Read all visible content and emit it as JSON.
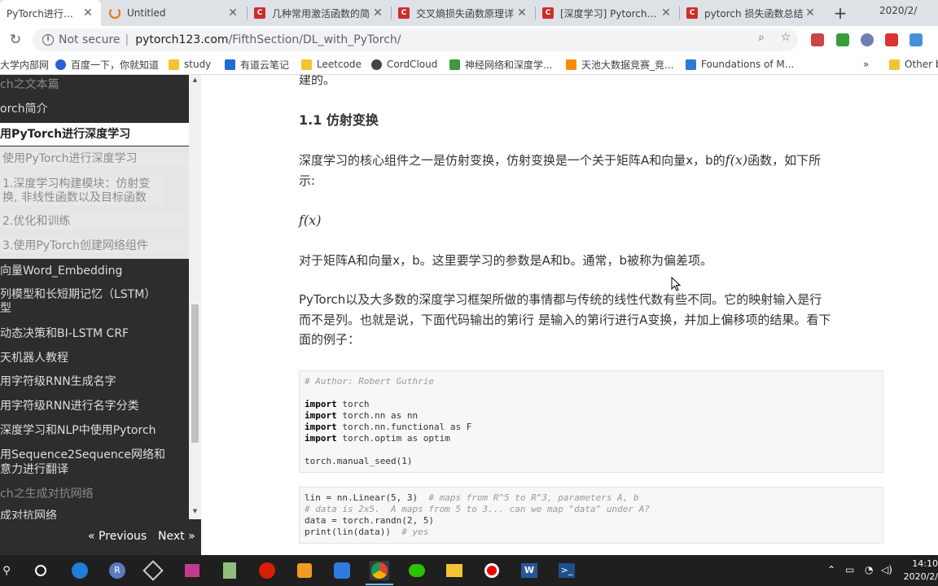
{
  "browser": {
    "tabs": [
      {
        "label": "PyTorch进行深度",
        "icon": "pytorch-favicon",
        "active": true
      },
      {
        "label": "Untitled",
        "icon": "loading-icon",
        "active": false
      },
      {
        "label": "几种常用激活函数的简",
        "icon": "csdn-favicon",
        "active": false
      },
      {
        "label": "交叉熵损失函数原理详",
        "icon": "csdn-favicon",
        "active": false
      },
      {
        "label": "[深度学习] Pytorch nn",
        "icon": "csdn-favicon",
        "active": false
      },
      {
        "label": "pytorch 损失函数总结",
        "icon": "csdn-favicon",
        "active": false
      }
    ],
    "new_tab": "+",
    "date_partial": "2020/2/",
    "omnibox": {
      "security": "Not secure",
      "separator": "|",
      "host": "pytorch123.com",
      "path": "/FifthSection/DL_with_PyTorch/"
    },
    "bookmarks": [
      {
        "label": "大学内部网",
        "icon": "globe-icon"
      },
      {
        "label": "百度一下，你就知道",
        "icon": "baidu-icon"
      },
      {
        "label": "study",
        "icon": "folder-icon"
      },
      {
        "label": "有道云笔记",
        "icon": "youdao-icon"
      },
      {
        "label": "Leetcode",
        "icon": "folder-icon"
      },
      {
        "label": "CordCloud",
        "icon": "cordcloud-icon"
      },
      {
        "label": "神经网络和深度学...",
        "icon": "nn-icon"
      },
      {
        "label": "天池大数据竞赛_竞...",
        "icon": "tianchi-icon"
      },
      {
        "label": "Foundations of M...",
        "icon": "foundations-icon"
      },
      {
        "label": "»",
        "icon": "more-icon"
      },
      {
        "label": "Other b",
        "icon": "folder-icon"
      }
    ]
  },
  "sidebar": {
    "items": [
      {
        "label": "ch之文本篇",
        "style": "dim"
      },
      {
        "label": "orch简介",
        "style": "normal"
      },
      {
        "label": "用PyTorch进行深度学习",
        "style": "active"
      },
      {
        "label": "使用PyTorch进行深度学习",
        "style": "sub"
      },
      {
        "label": "1.深度学习构建模块：仿射变换, 非线性函数以及目标函数",
        "style": "sub"
      },
      {
        "label": "2.优化和训练",
        "style": "sub"
      },
      {
        "label": "3.使用PyTorch创建网络组件",
        "style": "sub"
      },
      {
        "label": "向量Word_Embedding",
        "style": "normal"
      },
      {
        "label": "列模型和长短期记忆（LSTM）",
        "style": "normal"
      },
      {
        "label": "型",
        "style": "normal"
      },
      {
        "label": "动态决策和BI-LSTM CRF",
        "style": "normal"
      },
      {
        "label": "天机器人教程",
        "style": "normal"
      },
      {
        "label": "用字符级RNN生成名字",
        "style": "normal"
      },
      {
        "label": "用字符级RNN进行名字分类",
        "style": "normal"
      },
      {
        "label": "深度学习和NLP中使用Pytorch",
        "style": "normal"
      },
      {
        "label": "用Sequence2Sequence网络和",
        "style": "normal"
      },
      {
        "label": "意力进行翻译",
        "style": "normal"
      },
      {
        "label": "ch之生成对抗网络",
        "style": "dim"
      },
      {
        "label": "成对抗网络",
        "style": "normal"
      }
    ],
    "previous": "« Previous",
    "next": "Next »"
  },
  "content": {
    "top_fragment": "建的。",
    "heading": "1.1 仿射变换",
    "para1_a": "深度学习的核心组件之一是仿射变换，仿射变换是一个关于矩阵A和向量x，b的",
    "para1_math": "f(x)",
    "para1_b": "函数，如下所",
    "para1_c": "示:",
    "formula": "f(x)",
    "para2": "对于矩阵A和向量x，b。这里要学习的参数是A和b。通常，b被称为偏差项。",
    "para3_l1": "PyTorch以及大多数的深度学习框架所做的事情都与传统的线性代数有些不同。它的映射输入是行",
    "para3_l2": "而不是列。也就是说，下面代码输出的第i行 是输入的第i行进行A变换，并加上偏移项的结果。看下",
    "para3_l3": "面的例子：",
    "code1": {
      "comment": "# Author: Robert Guthrie",
      "lines": [
        {
          "kw": "import",
          "rest": " torch"
        },
        {
          "kw": "import",
          "rest": " torch.nn as nn"
        },
        {
          "kw": "import",
          "rest": " torch.nn.functional as F"
        },
        {
          "kw": "import",
          "rest": " torch.optim as optim"
        }
      ],
      "seed": "torch.manual_seed(1)"
    },
    "code2": {
      "l1_code": "lin = nn.Linear(5, 3)  ",
      "l1_comment": "# maps from R^5 to R^3, parameters A, b",
      "l2_comment": "# data is 2x5.  A maps from 5 to 3... can we map \"data\" under A?",
      "l3_code": "data = torch.randn(2, 5)",
      "l4_code": "print(lin(data))  ",
      "l4_comment": "# yes"
    }
  },
  "taskbar": {
    "time": "14:10",
    "date": "2020/2/"
  }
}
